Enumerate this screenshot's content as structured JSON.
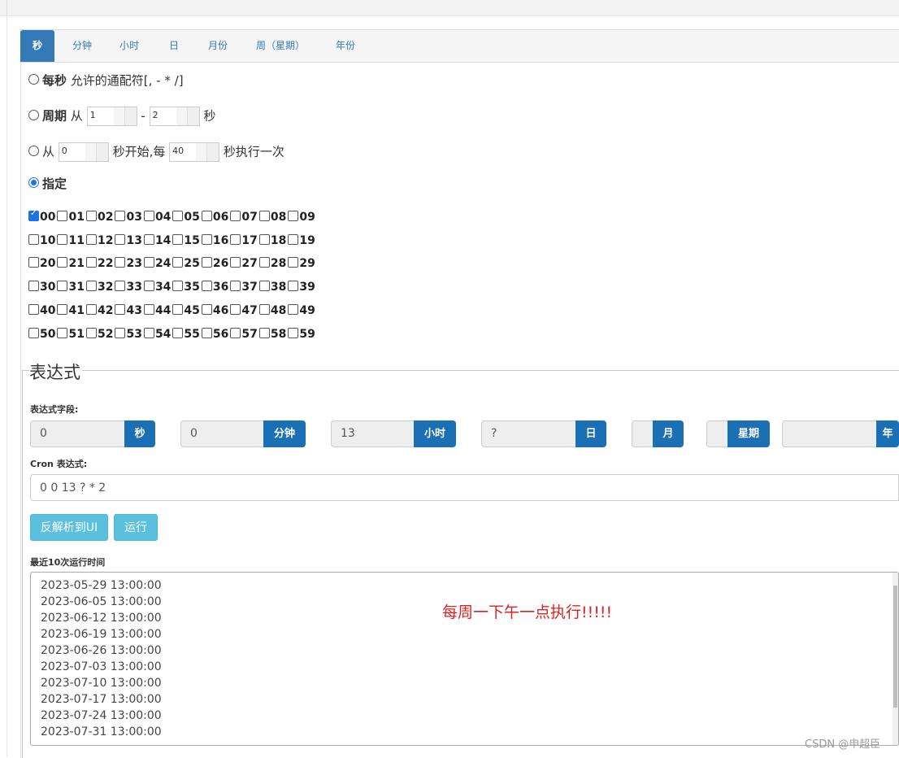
{
  "tabs": [
    "秒",
    "分钟",
    "小时",
    "日",
    "月份",
    "周（星期）",
    "年份"
  ],
  "options": {
    "every": {
      "label": "每秒",
      "desc": "允许的通配符[, - * /]"
    },
    "period": {
      "label": "周期",
      "from": "从",
      "from_val": "1",
      "dash": "-",
      "to_val": "2",
      "unit": "秒"
    },
    "step": {
      "from": "从",
      "start_val": "0",
      "mid": "秒开始,每",
      "every_val": "40",
      "tail": "秒执行一次"
    },
    "specific": {
      "label": "指定"
    }
  },
  "seconds_checked": [
    "00"
  ],
  "second_rows": [
    [
      "00",
      "01",
      "02",
      "03",
      "04",
      "05",
      "06",
      "07",
      "08",
      "09"
    ],
    [
      "10",
      "11",
      "12",
      "13",
      "14",
      "15",
      "16",
      "17",
      "18",
      "19"
    ],
    [
      "20",
      "21",
      "22",
      "23",
      "24",
      "25",
      "26",
      "27",
      "28",
      "29"
    ],
    [
      "30",
      "31",
      "32",
      "33",
      "34",
      "35",
      "36",
      "37",
      "38",
      "39"
    ],
    [
      "40",
      "41",
      "42",
      "43",
      "44",
      "45",
      "46",
      "47",
      "48",
      "49"
    ],
    [
      "50",
      "51",
      "52",
      "53",
      "54",
      "55",
      "56",
      "57",
      "58",
      "59"
    ]
  ],
  "expression": {
    "legend": "表达式",
    "fields_label": "表达式字段:",
    "fields": [
      {
        "value": "0",
        "label": "秒"
      },
      {
        "value": "0",
        "label": "分钟"
      },
      {
        "value": "13",
        "label": "小时"
      },
      {
        "value": "?",
        "label": "日"
      },
      {
        "value": "",
        "label": "月"
      },
      {
        "value": "",
        "label": "星期"
      },
      {
        "value": "",
        "label": "年"
      }
    ],
    "cron_label": "Cron 表达式:",
    "cron_value": "0 0 13 ? * 2",
    "parse_button": "反解析到UI",
    "run_button": "运行",
    "recent_label": "最近10次运行时间",
    "recent_runs": [
      "2023-05-29 13:00:00",
      "2023-06-05 13:00:00",
      "2023-06-12 13:00:00",
      "2023-06-19 13:00:00",
      "2023-06-26 13:00:00",
      "2023-07-03 13:00:00",
      "2023-07-10 13:00:00",
      "2023-07-17 13:00:00",
      "2023-07-24 13:00:00",
      "2023-07-31 13:00:00"
    ]
  },
  "annotation": "每周一下午一点执行!!!!!",
  "watermark": "CSDN @申超臣",
  "colors": {
    "primary": "#337ab7",
    "addon": "#1a6fb5",
    "info": "#5bc0de",
    "note": "#e02020"
  }
}
